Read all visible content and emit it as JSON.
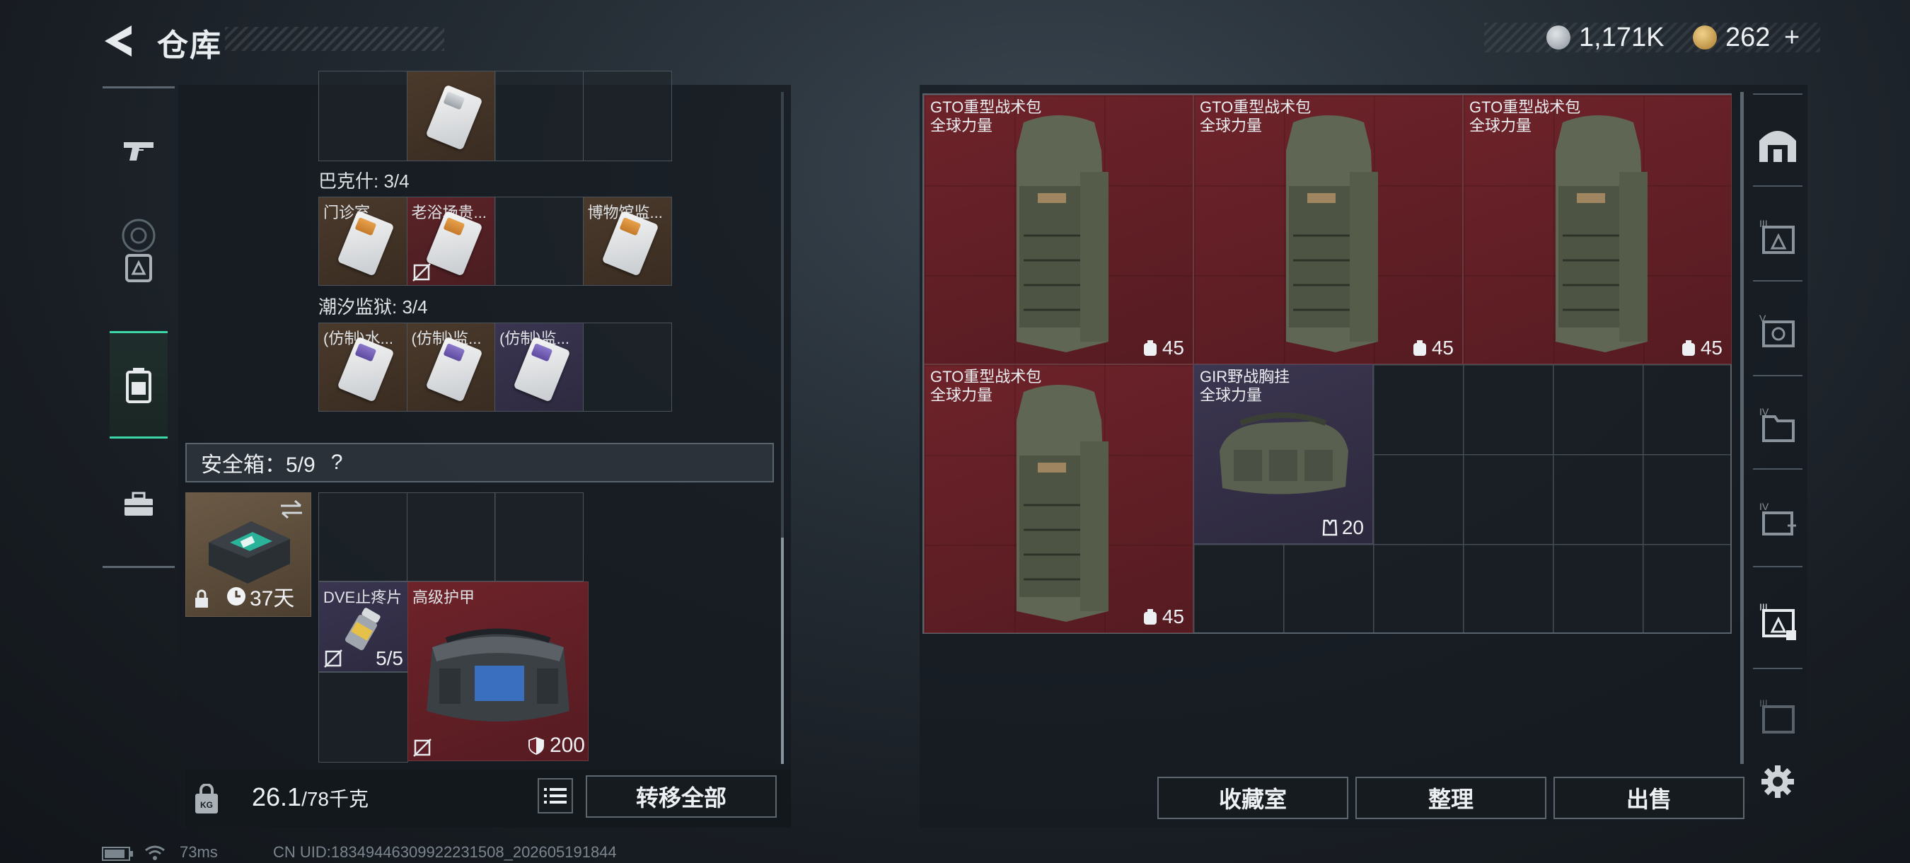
{
  "header": {
    "title": "仓库",
    "currency_silver": "1,171K",
    "currency_gold": "262",
    "currency_add": "+"
  },
  "left_nav": {
    "icons": [
      "pistol-icon",
      "safe-box-icon",
      "backpack-icon",
      "toolbox-icon"
    ]
  },
  "keycards": {
    "top_row": [
      {
        "label": "",
        "color": "white"
      }
    ],
    "bakesh": {
      "header": "巴克什: 3/4",
      "cells": [
        {
          "label": "门诊室",
          "bg": "brown"
        },
        {
          "label": "老浴场贵...",
          "bg": "red",
          "no_trade": true
        },
        {
          "label": "",
          "bg": "empty"
        },
        {
          "label": "博物馆监...",
          "bg": "brown"
        }
      ]
    },
    "tide_prison": {
      "header": "潮汐监狱: 3/4",
      "cells": [
        {
          "label": "(仿制)水...",
          "bg": "brown"
        },
        {
          "label": "(仿制)监...",
          "bg": "brown"
        },
        {
          "label": "(仿制)监...",
          "bg": "purple"
        },
        {
          "label": "",
          "bg": "empty"
        }
      ]
    }
  },
  "safe": {
    "header": "安全箱：5/9",
    "help": "?",
    "timer": "37天",
    "items": [
      {
        "name": "DVE止疼片",
        "count": "5/5"
      },
      {
        "name": "高级护甲",
        "count": "200"
      }
    ]
  },
  "weight": {
    "value": "26.1",
    "max": "/78千克"
  },
  "buttons": {
    "transfer_all": "转移全部",
    "collection": "收藏室",
    "organize": "整理",
    "sell": "出售"
  },
  "inventory": {
    "items": [
      {
        "name": "GTO重型战术包",
        "sub": "全球力量",
        "count": "45"
      },
      {
        "name": "GTO重型战术包",
        "sub": "全球力量",
        "count": "45"
      },
      {
        "name": "GTO重型战术包",
        "sub": "全球力量",
        "count": "45"
      },
      {
        "name": "GTO重型战术包",
        "sub": "全球力量",
        "count": "45"
      },
      {
        "name": "GIR野战胸挂",
        "sub": "全球力量",
        "count": "20"
      }
    ]
  },
  "status": {
    "ping": "73ms",
    "uid": "CN UID:1834944630992223150‍8_202605191844"
  },
  "colors": {
    "accent": "#3cd6a8",
    "red_item": "#6e232a",
    "purple_item": "#3c3650"
  }
}
